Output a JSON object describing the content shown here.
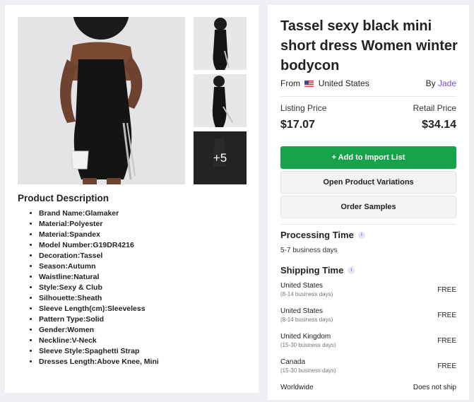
{
  "product": {
    "title": "Tassel sexy black mini short dress Women winter bodycon",
    "from_label": "From",
    "origin_country": "United States",
    "by_label": "By",
    "seller": "Jade",
    "listing_price_label": "Listing Price",
    "retail_price_label": "Retail Price",
    "listing_price": "$17.07",
    "retail_price": "$34.14"
  },
  "gallery": {
    "more_count": "+5"
  },
  "buttons": {
    "add_to_import": "+ Add to Import List",
    "open_variations": "Open Product Variations",
    "order_samples": "Order Samples"
  },
  "description": {
    "title": "Product Description",
    "items": [
      "Brand Name:Glamaker",
      "Material:Polyester",
      "Material:Spandex",
      "Model Number:G19DR4216",
      "Decoration:Tassel",
      "Season:Autumn",
      "Waistline:Natural",
      "Style:Sexy & Club",
      "Silhouette:Sheath",
      "Sleeve Length(cm):Sleeveless",
      "Pattern Type:Solid",
      "Gender:Women",
      "Neckline:V-Neck",
      "Sleeve Style:Spaghetti Strap",
      "Dresses Length:Above Knee, Mini"
    ]
  },
  "processing": {
    "title": "Processing Time",
    "value": "5-7 business days"
  },
  "shipping": {
    "title": "Shipping Time",
    "rows": [
      {
        "country": "United States",
        "days": "(8-14 business days)",
        "cost": "FREE"
      },
      {
        "country": "United States",
        "days": "(8-14 business days)",
        "cost": "FREE"
      },
      {
        "country": "United Kingdom",
        "days": "(15-30 business days)",
        "cost": "FREE"
      },
      {
        "country": "Canada",
        "days": "(15-30 business days)",
        "cost": "FREE"
      },
      {
        "country": "Worldwide",
        "days": "",
        "cost": "Does not ship"
      }
    ]
  },
  "colors": {
    "primary_button": "#16a34a",
    "seller_link": "#7b4fc7"
  }
}
